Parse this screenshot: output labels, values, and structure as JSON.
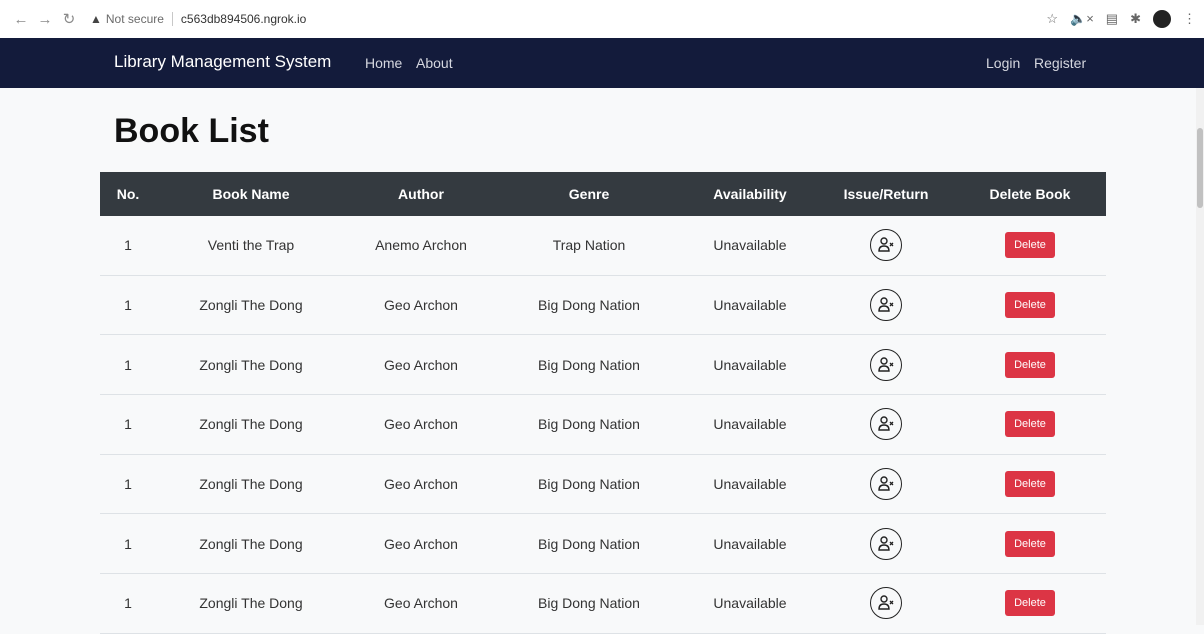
{
  "browser": {
    "back_icon": "arrow-left",
    "forward_icon": "arrow-right",
    "reload_icon": "reload",
    "not_secure": "Not secure",
    "host": "c563db894506.ngrok.io"
  },
  "navbar": {
    "brand": "Library Management System",
    "links": [
      "Home",
      "About"
    ],
    "login": "Login",
    "register": "Register"
  },
  "page": {
    "title": "Book List"
  },
  "table": {
    "headers": [
      "No.",
      "Book Name",
      "Author",
      "Genre",
      "Availability",
      "Issue/Return",
      "Delete Book"
    ],
    "rows": [
      {
        "no": "1",
        "book": "Venti the Trap",
        "author": "Anemo Archon",
        "genre": "Trap Nation",
        "availability": "Unavailable",
        "delete": "Delete"
      },
      {
        "no": "1",
        "book": "Zongli The Dong",
        "author": "Geo Archon",
        "genre": "Big Dong Nation",
        "availability": "Unavailable",
        "delete": "Delete"
      },
      {
        "no": "1",
        "book": "Zongli The Dong",
        "author": "Geo Archon",
        "genre": "Big Dong Nation",
        "availability": "Unavailable",
        "delete": "Delete"
      },
      {
        "no": "1",
        "book": "Zongli The Dong",
        "author": "Geo Archon",
        "genre": "Big Dong Nation",
        "availability": "Unavailable",
        "delete": "Delete"
      },
      {
        "no": "1",
        "book": "Zongli The Dong",
        "author": "Geo Archon",
        "genre": "Big Dong Nation",
        "availability": "Unavailable",
        "delete": "Delete"
      },
      {
        "no": "1",
        "book": "Zongli The Dong",
        "author": "Geo Archon",
        "genre": "Big Dong Nation",
        "availability": "Unavailable",
        "delete": "Delete"
      },
      {
        "no": "1",
        "book": "Zongli The Dong",
        "author": "Geo Archon",
        "genre": "Big Dong Nation",
        "availability": "Unavailable",
        "delete": "Delete"
      }
    ]
  },
  "colors": {
    "navbar": "#131b3b",
    "table_header": "#343a40",
    "delete_button": "#dc3545"
  }
}
